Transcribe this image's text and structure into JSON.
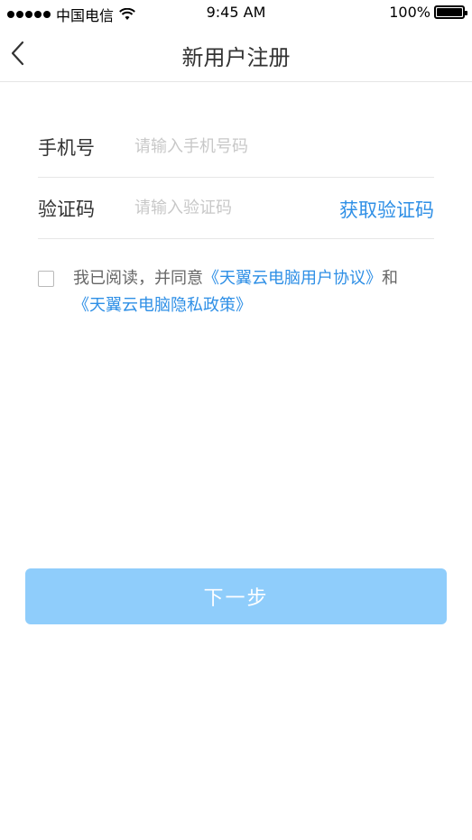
{
  "status_bar": {
    "carrier": "中国电信",
    "time": "9:45 AM",
    "battery": "100%",
    "signal_icon": "signal-dots-icon",
    "wifi_icon": "wifi-icon",
    "battery_icon": "battery-icon"
  },
  "nav": {
    "title": "新用户注册",
    "back_icon": "chevron-left-icon"
  },
  "form": {
    "phone_label": "手机号",
    "phone_placeholder": "请输入手机号码",
    "code_label": "验证码",
    "code_placeholder": "请输入验证码",
    "get_code": "获取验证码"
  },
  "agreement": {
    "prefix": "我已阅读，并同意",
    "user_agreement": "《天翼云电脑用户协议》",
    "conjunction": "和",
    "privacy_policy": "《天翼云电脑隐私政策》",
    "checked": false
  },
  "next_button": "下一步",
  "colors": {
    "link": "#2e8fe6",
    "button_disabled": "#8fcdfb",
    "divider": "#e6e6e6"
  }
}
